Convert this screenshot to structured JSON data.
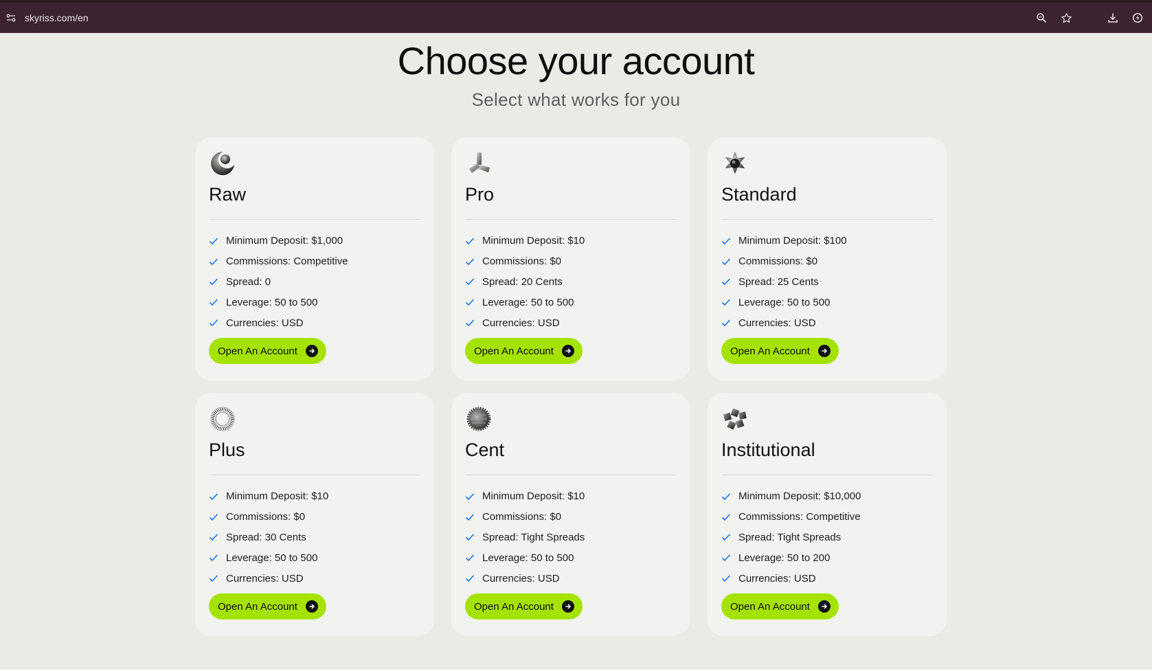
{
  "browser": {
    "url": "skyriss.com/en",
    "icons": [
      "site-info-icon",
      "zoom-icon",
      "bookmark-star-icon",
      "download-icon",
      "extension-icon"
    ]
  },
  "header": {
    "title": "Choose your account",
    "subtitle": "Select what works for you"
  },
  "accounts": [
    {
      "name": "Raw",
      "icon": "crescent-sphere-icon",
      "features": [
        "Minimum Deposit: $1,000",
        "Commissions: Competitive",
        "Spread: 0",
        "Leverage: 50 to 500",
        "Currencies: USD"
      ],
      "button": "Open An Account"
    },
    {
      "name": "Pro",
      "icon": "tripod-icon",
      "features": [
        "Minimum Deposit: $10",
        "Commissions: $0",
        "Spread: 20 Cents",
        "Leverage: 50 to 500",
        "Currencies: USD"
      ],
      "button": "Open An Account"
    },
    {
      "name": "Standard",
      "icon": "star-gem-icon",
      "features": [
        "Minimum Deposit: $100",
        "Commissions: $0",
        "Spread: 25 Cents",
        "Leverage: 50 to 500",
        "Currencies: USD"
      ],
      "button": "Open An Account"
    },
    {
      "name": "Plus",
      "icon": "spiky-ring-icon",
      "features": [
        "Minimum Deposit: $10",
        "Commissions: $0",
        "Spread: 30 Cents",
        "Leverage: 50 to 500",
        "Currencies: USD"
      ],
      "button": "Open An Account"
    },
    {
      "name": "Cent",
      "icon": "gear-disc-icon",
      "features": [
        "Minimum Deposit: $10",
        "Commissions: $0",
        "Spread: Tight Spreads",
        "Leverage: 50 to 500",
        "Currencies: USD"
      ],
      "button": "Open An Account"
    },
    {
      "name": "Institutional",
      "icon": "cube-cluster-icon",
      "features": [
        "Minimum Deposit: $10,000",
        "Commissions: Competitive",
        "Spread: Tight Spreads",
        "Leverage: 50 to 200",
        "Currencies: USD"
      ],
      "button": "Open An Account"
    }
  ],
  "colors": {
    "accent": "#a5e200",
    "check": "#1a73e8",
    "card_bg": "#f2f3f0",
    "page_bg": "#eaeae6",
    "browser_bar": "#3b2430"
  }
}
